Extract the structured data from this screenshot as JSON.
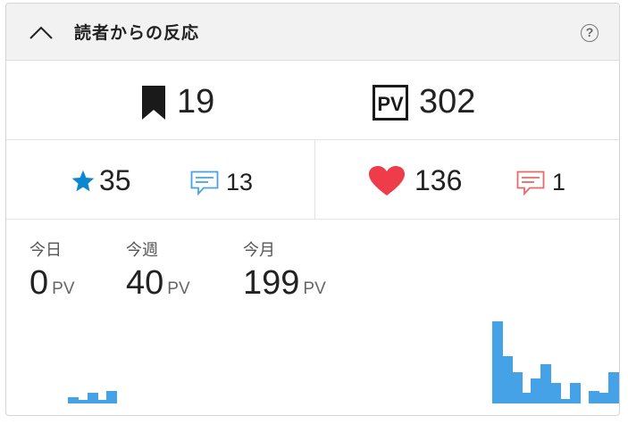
{
  "header": {
    "title": "読者からの反応",
    "help_label": "?"
  },
  "stats": {
    "bookmarks": "19",
    "page_views": "302",
    "pv_icon_label": "PV",
    "stars": "35",
    "star_comments": "13",
    "hearts": "136",
    "heart_comments": "1"
  },
  "pageviews": {
    "today_label": "今日",
    "today_value": "0",
    "week_label": "今週",
    "week_value": "40",
    "month_label": "今月",
    "month_value": "199",
    "unit": "PV"
  },
  "colors": {
    "accent_blue": "#45a2e6",
    "star_blue": "#0b86d1",
    "heart_red": "#ee3c4b",
    "comment_blue": "#4aa3df",
    "comment_red": "#e66a6a"
  },
  "chart_data": {
    "type": "bar",
    "values": [
      3,
      1,
      5,
      1,
      6,
      0,
      0,
      0,
      0,
      0,
      0,
      0,
      0,
      0,
      0,
      0,
      0,
      0,
      0,
      0,
      0,
      0,
      0,
      0,
      0,
      0,
      0,
      0,
      0,
      0,
      0,
      0,
      0,
      0,
      0,
      0,
      0,
      0,
      0,
      0,
      0,
      0,
      0,
      0,
      40,
      23,
      15,
      5,
      12,
      19,
      10,
      2,
      10,
      0,
      6,
      5,
      15
    ],
    "title": "",
    "xlabel": "",
    "ylabel": ""
  }
}
